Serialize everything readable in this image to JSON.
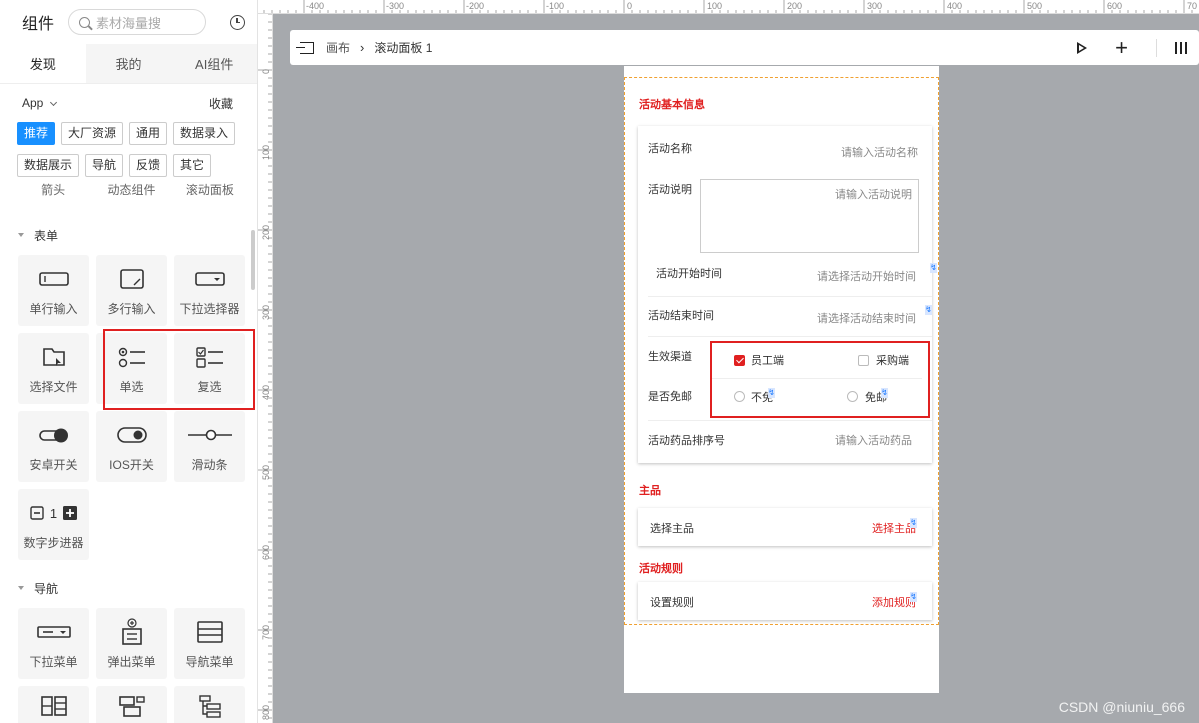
{
  "panel": {
    "title": "组件",
    "search_placeholder": "素材海量搜",
    "tabs": [
      "发现",
      "我的",
      "AI组件"
    ],
    "app_label": "App",
    "favorite_label": "收藏",
    "chips": [
      "推荐",
      "大厂资源",
      "通用",
      "数据录入",
      "数据展示",
      "导航",
      "反馈",
      "其它"
    ],
    "cut_items": [
      "箭头",
      "动态组件",
      "滚动面板"
    ],
    "section_form": "表单",
    "form_items": [
      "单行输入",
      "多行输入",
      "下拉选择器",
      "选择文件",
      "单选",
      "复选",
      "安卓开关",
      "IOS开关",
      "滑动条",
      "数字步进器"
    ],
    "stepper_value": "1",
    "section_nav": "导航",
    "nav_items": [
      "下拉菜单",
      "弹出菜单",
      "导航菜单"
    ]
  },
  "ruler": {
    "top": [
      "-400",
      "-300",
      "-200",
      "-100",
      "0",
      "100",
      "200",
      "300",
      "400",
      "500",
      "600",
      "70"
    ],
    "left": [
      "0",
      "100",
      "200",
      "300",
      "400",
      "500",
      "600",
      "700",
      "800"
    ]
  },
  "toolbar": {
    "canvas": "画布",
    "separator": "›",
    "current": "滚动面板 1"
  },
  "form": {
    "section_basic": "活动基本信息",
    "name_label": "活动名称",
    "name_placeholder": "请输入活动名称",
    "desc_label": "活动说明",
    "desc_placeholder": "请输入活动说明",
    "start_label": "活动开始时间",
    "start_placeholder": "请选择活动开始时间",
    "end_label": "活动结束时间",
    "end_placeholder": "请选择活动结束时间",
    "channel_label": "生效渠道",
    "channel_opt1": "员工端",
    "channel_opt2": "采购端",
    "shipping_label": "是否免邮",
    "shipping_opt1": "不免",
    "shipping_opt2": "免邮",
    "sort_label": "活动药品排序号",
    "sort_placeholder": "请输入活动药品",
    "section_main": "主品",
    "main_label": "选择主品",
    "main_link": "选择主品",
    "section_rules": "活动规则",
    "rules_label": "设置规则",
    "rules_link": "添加规则"
  },
  "watermark": "CSDN @niuniu_666",
  "colors": {
    "accent_blue": "#1890ff",
    "red": "#e02020",
    "canvas_bg": "#a6a9ad"
  }
}
